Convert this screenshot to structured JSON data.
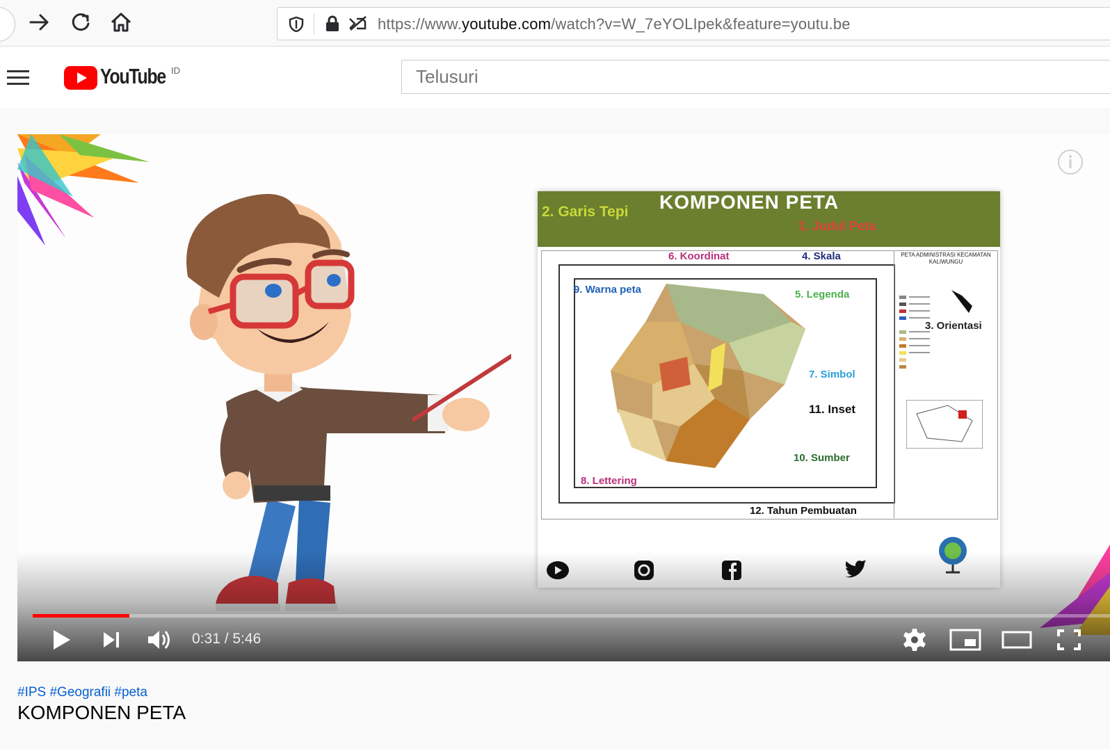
{
  "browser": {
    "url_prefix": "https://www.",
    "url_domain": "youtube.com",
    "url_path": "/watch?v=W_7eYOLIpek&feature=youtu.be",
    "icons": [
      "back-icon",
      "forward-icon",
      "reload-icon",
      "home-icon",
      "shield-icon",
      "lock-icon",
      "permissions-icon"
    ]
  },
  "youtube": {
    "logo_text": "YouTube",
    "country_code": "ID",
    "search_placeholder": "Telusuri",
    "brand_color": "#ff0000"
  },
  "player": {
    "current_time": "0:31",
    "duration": "5:46",
    "time_display": "0:31 / 5:46",
    "progress_fraction": 0.09,
    "controls": [
      "play-icon",
      "next-icon",
      "volume-icon",
      "settings-icon",
      "miniplayer-icon",
      "theater-icon",
      "fullscreen-icon"
    ]
  },
  "slide": {
    "title": "KOMPONEN PETA",
    "labels": {
      "judul": "1. Judul Peta",
      "garis_tepi": "2. Garis Tepi",
      "orientasi": "3. Orientasi",
      "skala": "4. Skala",
      "legenda": "5. Legenda",
      "koordinat": "6. Koordinat",
      "simbol": "7. Simbol",
      "lettering": "8. Lettering",
      "warna": "9. Warna peta",
      "sumber": "10. Sumber",
      "inset": "11. Inset",
      "tahun": "12. Tahun Pembuatan"
    },
    "map_header": "PETA ADMINISTRASI KECAMATAN KALIWUNGU"
  },
  "video": {
    "hashtags": "#IPS #Geografii #peta",
    "title": "KOMPONEN PETA"
  }
}
